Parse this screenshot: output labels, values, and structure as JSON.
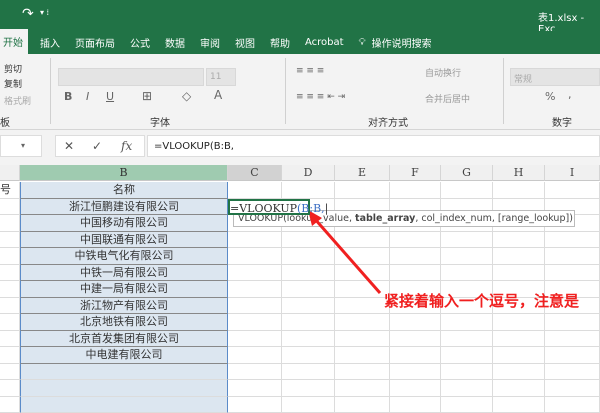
{
  "titlebar": {
    "filename": "表1.xlsx  -  Exc"
  },
  "tabs": [
    "开始",
    "插入",
    "页面布局",
    "公式",
    "数据",
    "审阅",
    "视图",
    "帮助",
    "Acrobat"
  ],
  "search_label": "操作说明搜索",
  "ribbon": {
    "clipboard": {
      "cut": "剪切",
      "copy": "复制",
      "format_painter": "格式刷",
      "label": "板"
    },
    "font": {
      "size": "11",
      "label": "字体",
      "bold": "B",
      "italic": "I",
      "underline": "U",
      "font_color": "A"
    },
    "alignment": {
      "wrap": "自动换行",
      "merge": "合并后居中",
      "label": "对齐方式"
    },
    "number": {
      "format": "常规",
      "percent": "%",
      "comma": ",",
      "label": "数字"
    }
  },
  "formula_bar": {
    "cancel": "✕",
    "enter": "✓",
    "fx": "fx",
    "value": "=VLOOKUP(B:B,"
  },
  "columns": [
    "B",
    "C",
    "D",
    "E",
    "F",
    "G",
    "H",
    "I"
  ],
  "column_a_header_partial": "号",
  "column_b": [
    "名称",
    "浙江恒鹏建设有限公司",
    "中国移动有限公司",
    "中国联通有限公司",
    "中铁电气化有限公司",
    "中铁一局有限公司",
    "中建一局有限公司",
    "浙江物产有限公司",
    "北京地铁有限公司",
    "北京首发集团有限公司",
    "中电建有限公司"
  ],
  "active_cell": {
    "prefix": "=VLOOKUP",
    "args": "(B:B,"
  },
  "tooltip": {
    "pre": "VLOOKUP(lookup_value, ",
    "bold": "table_array",
    "post": ", col_index_num, [range_lookup])"
  },
  "annotation": "紧接着输入一个逗号，注意是",
  "colors": {
    "excel_green": "#217346",
    "selection": "#dce6f0",
    "annotation": "#f02020"
  }
}
